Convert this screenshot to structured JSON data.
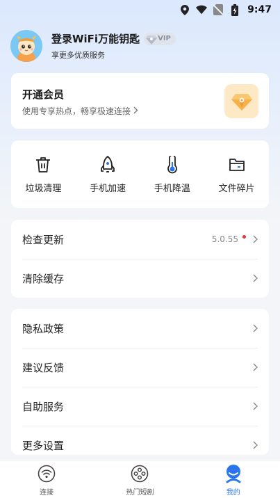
{
  "status_bar": {
    "time": "9:47"
  },
  "profile": {
    "title": "登录WiFi万能钥匙",
    "vip_label": "VIP",
    "subtitle": "享更多优质服务"
  },
  "vip_card": {
    "title": "开通会员",
    "subtitle": "使用专享热点，畅享极速连接"
  },
  "tools": [
    {
      "label": "垃圾清理",
      "icon": "trash-icon"
    },
    {
      "label": "手机加速",
      "icon": "rocket-icon"
    },
    {
      "label": "手机降温",
      "icon": "thermometer-icon"
    },
    {
      "label": "文件碎片",
      "icon": "folder-icon"
    }
  ],
  "update_list": [
    {
      "label": "检查更新",
      "value": "5.0.55"
    },
    {
      "label": "清除缓存"
    }
  ],
  "settings_list": [
    {
      "label": "隐私政策"
    },
    {
      "label": "建议反馈"
    },
    {
      "label": "自助服务"
    },
    {
      "label": "更多设置"
    }
  ],
  "tabbar": [
    {
      "label": "连接",
      "icon": "wifi-icon"
    },
    {
      "label": "热门短剧",
      "icon": "film-reel-icon"
    },
    {
      "label": "我的",
      "icon": "profile-icon",
      "active": true
    }
  ],
  "colors": {
    "accent": "#2b74f0",
    "badge_dot": "#e53935",
    "vip_icon_bg": "#fde9c6"
  }
}
